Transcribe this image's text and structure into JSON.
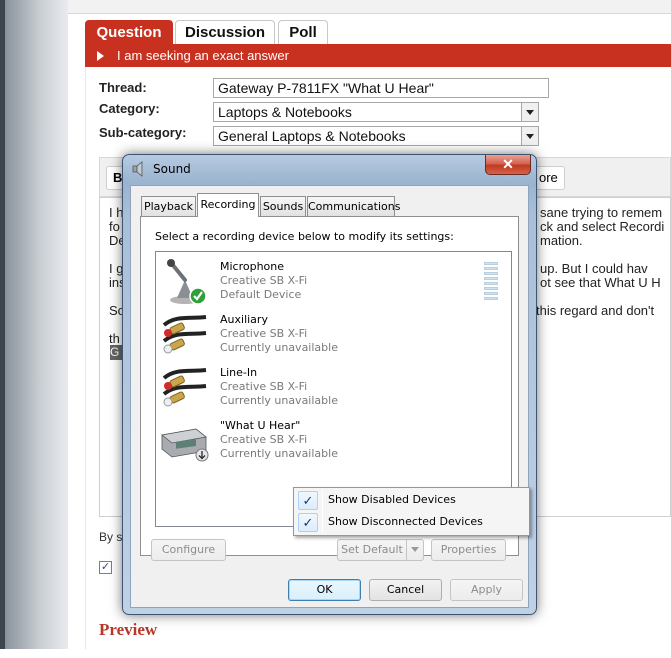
{
  "page": {
    "tabs": [
      "Question",
      "Discussion",
      "Poll"
    ],
    "seeking": "I am seeking an exact answer",
    "thread_label": "Thread:",
    "thread_value": "Gateway P-7811FX \"What U Hear\"",
    "category_label": "Category:",
    "category_value": "Laptops & Notebooks",
    "subcategory_label": "Sub-category:",
    "subcategory_value": "General Laptops & Notebooks",
    "toolbar_left": "B",
    "toolbar_right": "ore",
    "body_lines": [
      "I h",
      "fo",
      "De",
      "I g",
      "ins",
      "So",
      "th"
    ],
    "body_right_lines": [
      "sane trying to remem",
      "ck and select Recordi",
      "mation.",
      "up.   But I could hav",
      "ot see that What U H",
      " this regard and don't"
    ],
    "highlight": "G",
    "by_text": "By s",
    "checkbox_mark": "✓",
    "preview": "Preview"
  },
  "dialog": {
    "title": "Sound",
    "close": "✕",
    "tabs": [
      "Playback",
      "Recording",
      "Sounds",
      "Communications"
    ],
    "active_tab": "Recording",
    "instruction": "Select a recording device below to modify its settings:",
    "devices": [
      {
        "name": "Microphone",
        "driver": "Creative SB X-Fi",
        "status": "Default Device",
        "icon": "microphone-icon"
      },
      {
        "name": "Auxiliary",
        "driver": "Creative SB X-Fi",
        "status": "Currently unavailable",
        "icon": "rca-cable-icon"
      },
      {
        "name": "Line-In",
        "driver": "Creative SB X-Fi",
        "status": "Currently unavailable",
        "icon": "rca-cable-icon"
      },
      {
        "name": "\"What U Hear\"",
        "driver": "Creative SB X-Fi",
        "status": "Currently unavailable",
        "icon": "sound-card-icon"
      }
    ],
    "buttons": {
      "configure": "Configure",
      "set_default": "Set Default",
      "properties": "Properties",
      "ok": "OK",
      "cancel": "Cancel",
      "apply": "Apply"
    },
    "context_menu": [
      {
        "label": "Show Disabled Devices",
        "checked": true
      },
      {
        "label": "Show Disconnected Devices",
        "checked": true
      }
    ],
    "check_glyph": "✓",
    "accent_red": "#c8311f"
  }
}
